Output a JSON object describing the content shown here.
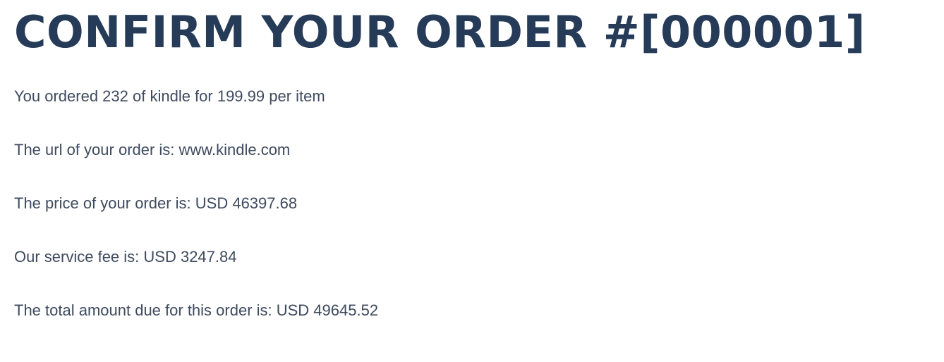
{
  "page": {
    "title": "CONFIRM YOUR ORDER #[000001]"
  },
  "order": {
    "summary_line": "You ordered 232 of kindle for 199.99 per item",
    "url_line": "The url of your order is: www.kindle.com",
    "price_line": "The price of your order is: USD 46397.68",
    "fee_line": "Our service fee is: USD 3247.84",
    "total_line": "The total amount due for this order is: USD 49645.52"
  },
  "colors": {
    "title": "#253b58",
    "body_text": "#3e4a5e",
    "background": "#ffffff"
  }
}
